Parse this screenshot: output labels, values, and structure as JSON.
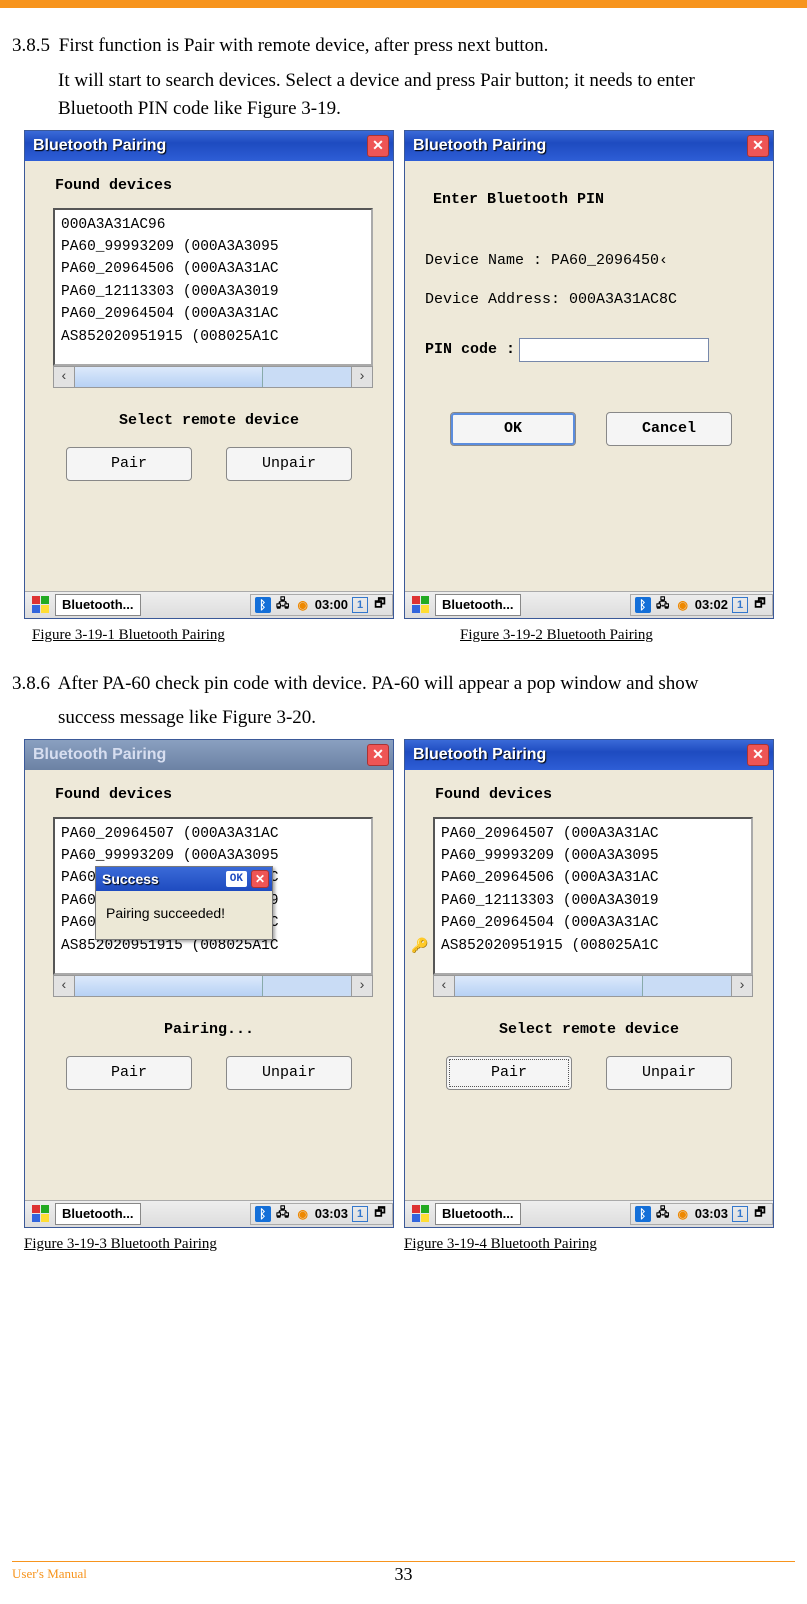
{
  "section_385": {
    "num": "3.8.5",
    "line1": "First function is Pair with remote device, after press next button.",
    "line2": "It will start to search devices. Select a device and press Pair button; it needs to enter",
    "line3": "Bluetooth PIN code like Figure 3-19."
  },
  "section_386": {
    "num": "3.8.6",
    "line1": "After PA-60 check pin code with device. PA-60 will appear a pop window and show",
    "line2": "success message like Figure 3-20."
  },
  "captions": {
    "c1": "Figure 3-19-1 Bluetooth Pairing",
    "c2": "Figure 3-19-2 Bluetooth Pairing",
    "c3": "Figure 3-19-3 Bluetooth Pairing",
    "c4": "Figure 3-19-4 Bluetooth Pairing"
  },
  "win_common": {
    "title": "Bluetooth Pairing",
    "found": "Found devices",
    "select": "Select remote device",
    "pairing": "Pairing...",
    "pair": "Pair",
    "unpair": "Unpair",
    "task": "Bluetooth...",
    "close": "✕"
  },
  "win1": {
    "devices": [
      "000A3A31AC96",
      "PA60_99993209 (000A3A3095",
      "PA60_20964506 (000A3A31AC",
      "PA60_12113303 (000A3A3019",
      "PA60_20964504 (000A3A31AC",
      "AS852020951915 (008025A1C"
    ],
    "time": "03:00"
  },
  "win2": {
    "enter": "Enter Bluetooth PIN",
    "dname_label": "Device Name   : ",
    "dname_value": "PA60_2096450‹",
    "daddr_label": "Device Address: ",
    "daddr_value": "000A3A31AC8C",
    "pin_label": "PIN code :",
    "ok": "OK",
    "cancel": "Cancel",
    "time": "03:02"
  },
  "win3": {
    "devices": [
      "PA60_20964507 (000A3A31AC",
      "PA60_99993209 (000A3A3095",
      "PA60_20964506 (000A3A31AC",
      "PA60_12113303 (000A3A3019",
      "PA60_20964504 (000A3A31AC",
      "AS852020951915 (008025A1C"
    ],
    "popup_title": "Success",
    "popup_ok": "OK",
    "popup_body": "Pairing succeeded!",
    "time": "03:03"
  },
  "win4": {
    "devices": [
      "PA60_20964507 (000A3A31AC",
      "PA60_99993209 (000A3A3095",
      "PA60_20964506 (000A3A31AC",
      "PA60_12113303 (000A3A3019",
      "PA60_20964504 (000A3A31AC",
      "AS852020951915 (008025A1C"
    ],
    "time": "03:03"
  },
  "footer": {
    "um": "User's Manual",
    "page": "33"
  }
}
